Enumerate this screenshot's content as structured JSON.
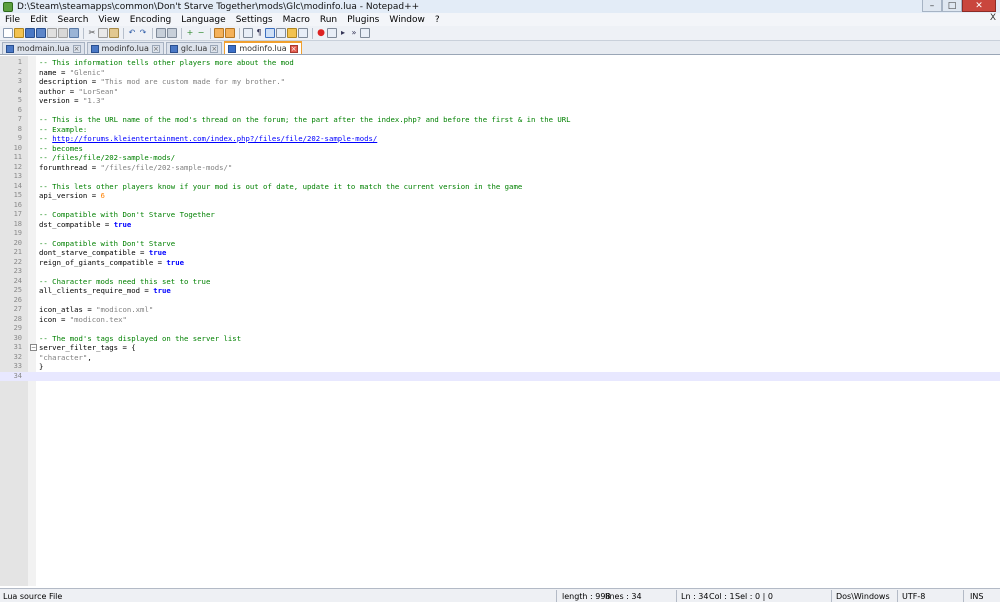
{
  "window": {
    "title": "D:\\Steam\\steamapps\\common\\Don't Starve Together\\mods\\Glc\\modinfo.lua - Notepad++",
    "minimize": "–",
    "maximize": "□",
    "close": "✕"
  },
  "menu": {
    "items": [
      "File",
      "Edit",
      "Search",
      "View",
      "Encoding",
      "Language",
      "Settings",
      "Macro",
      "Run",
      "Plugins",
      "Window",
      "?"
    ],
    "close_x": "X"
  },
  "tabs": [
    {
      "label": "modmain.lua",
      "active": false
    },
    {
      "label": "modinfo.lua",
      "active": false
    },
    {
      "label": "glc.lua",
      "active": false
    },
    {
      "label": "modinfo.lua",
      "active": true
    }
  ],
  "editor": {
    "current_line": 34,
    "fold_line": 31,
    "lines": [
      {
        "n": "1",
        "parts": [
          [
            "comment",
            "-- This information tells other players more about the mod"
          ]
        ]
      },
      {
        "n": "2",
        "parts": [
          [
            "plain",
            "name = "
          ],
          [
            "string",
            "\"Glenic\""
          ]
        ]
      },
      {
        "n": "3",
        "parts": [
          [
            "plain",
            "description = "
          ],
          [
            "string",
            "\"This mod are custom made for my brother.\""
          ]
        ]
      },
      {
        "n": "4",
        "parts": [
          [
            "plain",
            "author = "
          ],
          [
            "string",
            "\"LorSean\""
          ]
        ]
      },
      {
        "n": "5",
        "parts": [
          [
            "plain",
            "version = "
          ],
          [
            "string",
            "\"1.3\""
          ]
        ]
      },
      {
        "n": "6",
        "parts": []
      },
      {
        "n": "7",
        "parts": [
          [
            "comment",
            "-- This is the URL name of the mod's thread on the forum; the part after the index.php? and before the first & in the URL"
          ]
        ]
      },
      {
        "n": "8",
        "parts": [
          [
            "comment",
            "-- Example:"
          ]
        ]
      },
      {
        "n": "9",
        "parts": [
          [
            "comment",
            "-- "
          ],
          [
            "link",
            "http://forums.kleientertainment.com/index.php?/files/file/202-sample-mods/"
          ]
        ]
      },
      {
        "n": "10",
        "parts": [
          [
            "comment",
            "-- becomes"
          ]
        ]
      },
      {
        "n": "11",
        "parts": [
          [
            "comment",
            "-- /files/file/202-sample-mods/"
          ]
        ]
      },
      {
        "n": "12",
        "parts": [
          [
            "plain",
            "forumthread = "
          ],
          [
            "string",
            "\"/files/file/202-sample-mods/\""
          ]
        ]
      },
      {
        "n": "13",
        "parts": []
      },
      {
        "n": "14",
        "parts": [
          [
            "comment",
            "-- This lets other players know if your mod is out of date, update it to match the current version in the game"
          ]
        ]
      },
      {
        "n": "15",
        "parts": [
          [
            "plain",
            "api_version = "
          ],
          [
            "number",
            "6"
          ]
        ]
      },
      {
        "n": "16",
        "parts": []
      },
      {
        "n": "17",
        "parts": [
          [
            "comment",
            "-- Compatible with Don't Starve Together"
          ]
        ]
      },
      {
        "n": "18",
        "parts": [
          [
            "plain",
            "dst_compatible = "
          ],
          [
            "keyword",
            "true"
          ]
        ]
      },
      {
        "n": "19",
        "parts": []
      },
      {
        "n": "20",
        "parts": [
          [
            "comment",
            "-- Compatible with Don't Starve"
          ]
        ]
      },
      {
        "n": "21",
        "parts": [
          [
            "plain",
            "dont_starve_compatible = "
          ],
          [
            "keyword",
            "true"
          ]
        ]
      },
      {
        "n": "22",
        "parts": [
          [
            "plain",
            "reign_of_giants_compatible = "
          ],
          [
            "keyword",
            "true"
          ]
        ]
      },
      {
        "n": "23",
        "parts": []
      },
      {
        "n": "24",
        "parts": [
          [
            "comment",
            "-- Character mods need this set to true"
          ]
        ]
      },
      {
        "n": "25",
        "parts": [
          [
            "plain",
            "all_clients_require_mod = "
          ],
          [
            "keyword",
            "true"
          ]
        ]
      },
      {
        "n": "26",
        "parts": []
      },
      {
        "n": "27",
        "parts": [
          [
            "plain",
            "icon_atlas = "
          ],
          [
            "string",
            "\"modicon.xml\""
          ]
        ]
      },
      {
        "n": "28",
        "parts": [
          [
            "plain",
            "icon = "
          ],
          [
            "string",
            "\"modicon.tex\""
          ]
        ]
      },
      {
        "n": "29",
        "parts": []
      },
      {
        "n": "30",
        "parts": [
          [
            "comment",
            "-- The mod's tags displayed on the server list"
          ]
        ]
      },
      {
        "n": "31",
        "parts": [
          [
            "plain",
            "server_filter_tags = {"
          ]
        ]
      },
      {
        "n": "32",
        "parts": [
          [
            "string",
            "\"character\""
          ],
          [
            "plain",
            ","
          ]
        ]
      },
      {
        "n": "33",
        "parts": [
          [
            "plain",
            "}"
          ]
        ]
      },
      {
        "n": "34",
        "parts": []
      }
    ]
  },
  "status": {
    "filetype": "Lua source File",
    "length": "length : 998",
    "lines": "lines : 34",
    "ln": "Ln : 34",
    "col": "Col : 1",
    "sel": "Sel : 0 | 0",
    "eol": "Dos\\Windows",
    "encoding": "UTF-8",
    "mode": "INS"
  },
  "colors": {
    "comment": "#008000",
    "string": "#808080",
    "number": "#ff8000",
    "keyword": "#0000ff",
    "current_line": "#e8e8ff"
  }
}
